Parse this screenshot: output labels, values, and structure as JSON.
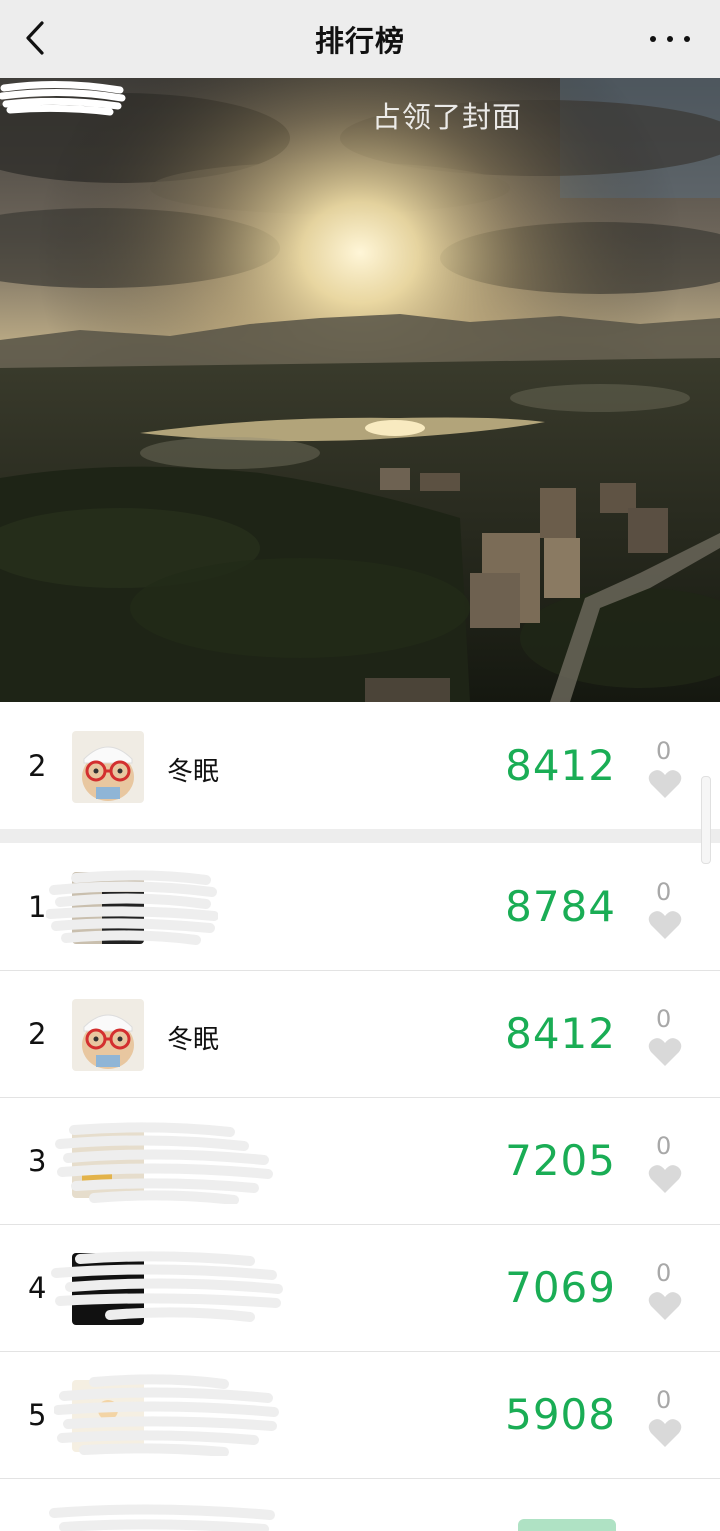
{
  "header": {
    "title": "排行榜"
  },
  "cover": {
    "caption": "占领了封面"
  },
  "my_rank": {
    "rank": "2",
    "name": "冬眠",
    "steps": "8412",
    "likes": "0"
  },
  "ranking": [
    {
      "rank": "1",
      "name": "",
      "steps": "8784",
      "likes": "0"
    },
    {
      "rank": "2",
      "name": "冬眠",
      "steps": "8412",
      "likes": "0"
    },
    {
      "rank": "3",
      "name": "",
      "steps": "7205",
      "likes": "0"
    },
    {
      "rank": "4",
      "name": "",
      "steps": "7069",
      "likes": "0"
    },
    {
      "rank": "5",
      "name": "",
      "steps": "5908",
      "likes": "0"
    }
  ],
  "colors": {
    "steps_green": "#1aad55",
    "nav_bg": "#ededed",
    "heart_grey": "#d9d9d9"
  },
  "icons": {
    "back": "chevron-left-icon",
    "more": "more-dots-icon",
    "like": "heart-icon"
  }
}
